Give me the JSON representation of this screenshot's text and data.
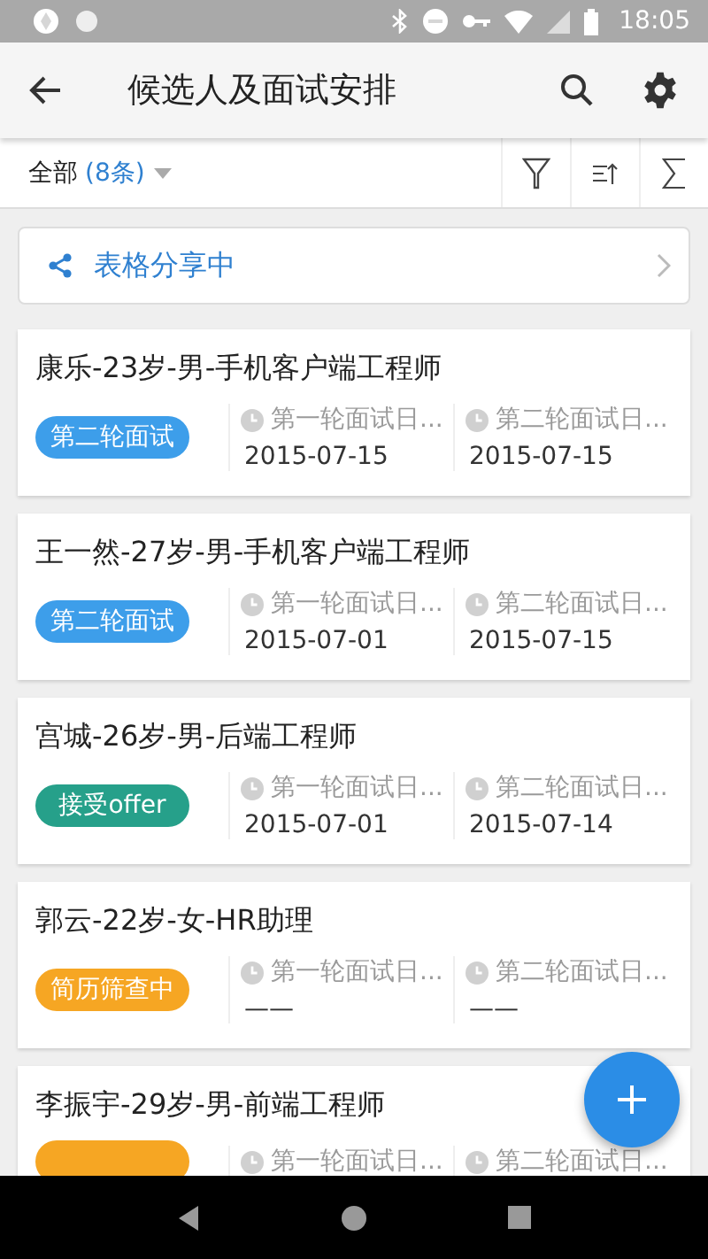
{
  "status_bar": {
    "time": "18:05"
  },
  "toolbar": {
    "title": "候选人及面试安排"
  },
  "filter_bar": {
    "scope": "全部",
    "count": "(8条)"
  },
  "share_banner": {
    "label": "表格分享中"
  },
  "candidates": [
    {
      "title": "康乐-23岁-男-手机客户端工程师",
      "tag": {
        "label": "第二轮面试",
        "color": "#3d9eea"
      },
      "fields": [
        {
          "label": "第一轮面试日...",
          "value": "2015-07-15"
        },
        {
          "label": "第二轮面试日...",
          "value": "2015-07-15"
        }
      ]
    },
    {
      "title": "王一然-27岁-男-手机客户端工程师",
      "tag": {
        "label": "第二轮面试",
        "color": "#3d9eea"
      },
      "fields": [
        {
          "label": "第一轮面试日...",
          "value": "2015-07-01"
        },
        {
          "label": "第二轮面试日...",
          "value": "2015-07-15"
        }
      ]
    },
    {
      "title": "宫城-26岁-男-后端工程师",
      "tag": {
        "label": "接受offer",
        "color": "#26a08a"
      },
      "fields": [
        {
          "label": "第一轮面试日...",
          "value": "2015-07-01"
        },
        {
          "label": "第二轮面试日...",
          "value": "2015-07-14"
        }
      ]
    },
    {
      "title": "郭云-22岁-女-HR助理",
      "tag": {
        "label": "简历筛查中",
        "color": "#f6a623"
      },
      "fields": [
        {
          "label": "第一轮面试日...",
          "value": "——"
        },
        {
          "label": "第二轮面试日...",
          "value": "——"
        }
      ]
    },
    {
      "title": "李振宇-29岁-男-前端工程师",
      "tag": {
        "color": "#f6a623"
      },
      "fields": [
        {
          "label": "第一轮面试日..."
        },
        {
          "label": "第二轮面试日..."
        }
      ]
    }
  ]
}
